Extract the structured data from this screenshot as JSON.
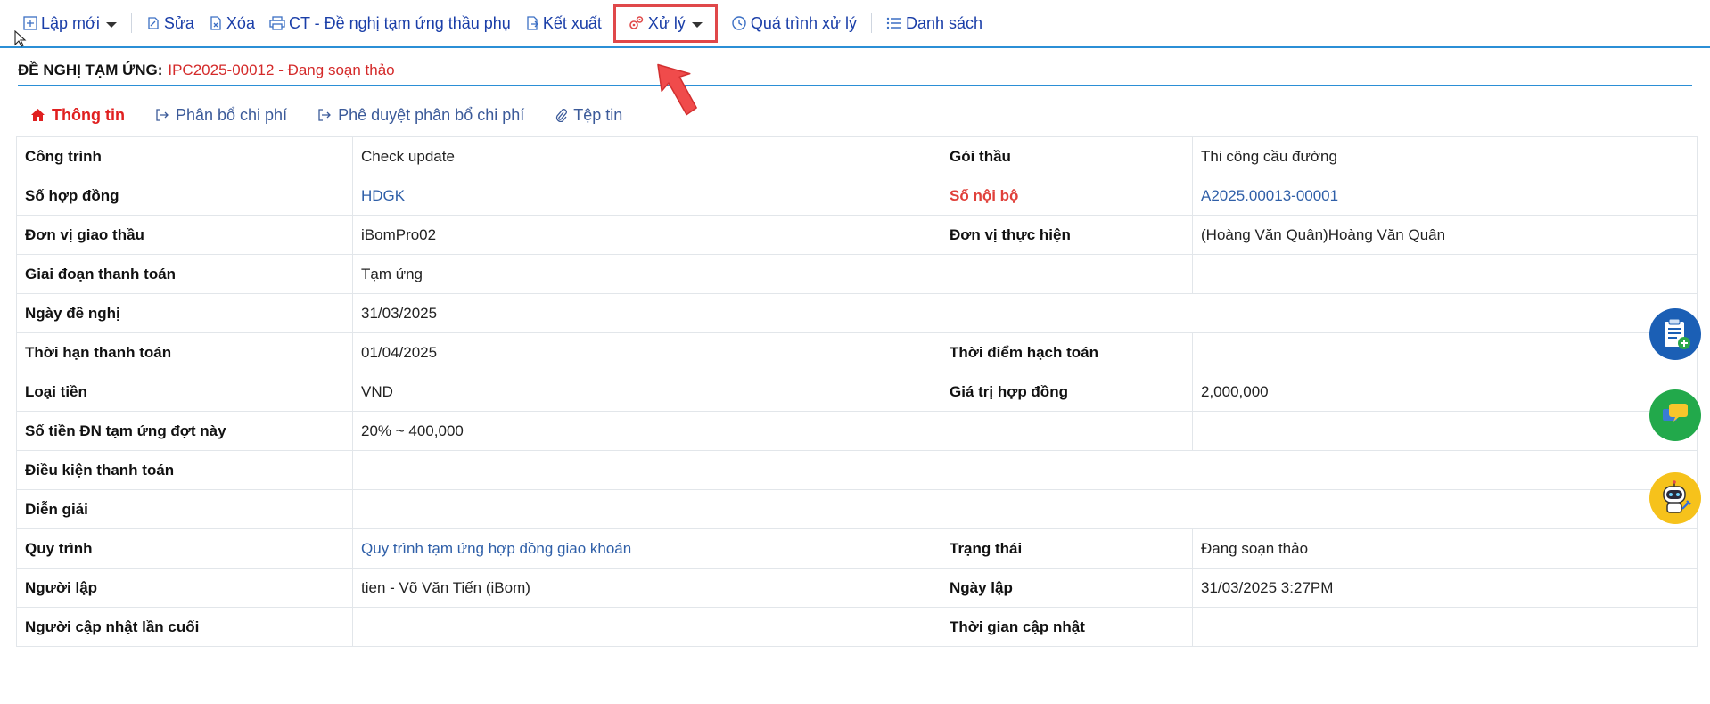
{
  "toolbar": {
    "new": "Lập mới",
    "edit": "Sửa",
    "delete": "Xóa",
    "print": "CT - Đề nghị tạm ứng thầu phụ",
    "export": "Kết xuất",
    "process": "Xử lý",
    "history": "Quá trình xử lý",
    "list": "Danh sách"
  },
  "header": {
    "label": "ĐỀ NGHỊ TẠM ỨNG:",
    "value": "IPC2025-00012 - Đang soạn thảo"
  },
  "tabs": [
    {
      "label": "Thông tin",
      "icon": "home-icon",
      "active": true
    },
    {
      "label": "Phân bổ chi phí",
      "icon": "share-icon"
    },
    {
      "label": "Phê duyệt phân bổ chi phí",
      "icon": "share-icon"
    },
    {
      "label": "Tệp tin",
      "icon": "paperclip-icon"
    }
  ],
  "info": {
    "r0": {
      "l1": "Công trình",
      "v1": "Check update",
      "l2": "Gói thầu",
      "v2": "Thi công cầu đường"
    },
    "r1": {
      "l1": "Số hợp đồng",
      "v1": "HDGK",
      "l2": "Số nội bộ",
      "v2": "A2025.00013-00001"
    },
    "r2": {
      "l1": "Đơn vị giao thầu",
      "v1": "iBomPro02",
      "l2": "Đơn vị thực hiện",
      "v2": "(Hoàng Văn Quân)Hoàng Văn Quân"
    },
    "r3": {
      "l1": "Giai đoạn thanh toán",
      "v1": "Tạm ứng"
    },
    "r4": {
      "l1": "Ngày đề nghị",
      "v1": "31/03/2025"
    },
    "r5": {
      "l1": "Thời hạn thanh toán",
      "v1": "01/04/2025",
      "l2": "Thời điểm hạch toán"
    },
    "r6": {
      "l1": "Loại tiền",
      "v1": "VND",
      "l2": "Giá trị hợp đồng",
      "v2": "2,000,000"
    },
    "r7": {
      "l1": "Số tiền ĐN tạm ứng đợt này",
      "v1": "20% ~ 400,000"
    },
    "r8": {
      "l1": "Điều kiện thanh toán"
    },
    "r9": {
      "l1": "Diễn giải"
    },
    "r10": {
      "l1": "Quy trình",
      "v1": "Quy trình tạm ứng hợp đồng giao khoán",
      "l2": "Trạng thái",
      "v2": "Đang soạn thảo"
    },
    "r11": {
      "l1": "Người lập",
      "v1": "tien - Võ Văn Tiến (iBom)",
      "l2": "Ngày lập",
      "v2": "31/03/2025 3:27PM"
    },
    "r12": {
      "l1": "Người cập nhật lần cuối",
      "l2": "Thời gian cập nhật"
    }
  },
  "floating": [
    "clipboard-add-icon",
    "chat-icon",
    "robot-support-icon"
  ],
  "colors": {
    "accent": "#2b8fd6",
    "link": "#1a3ea8",
    "status": "#d42a2a",
    "highlight": "#e0484a"
  }
}
